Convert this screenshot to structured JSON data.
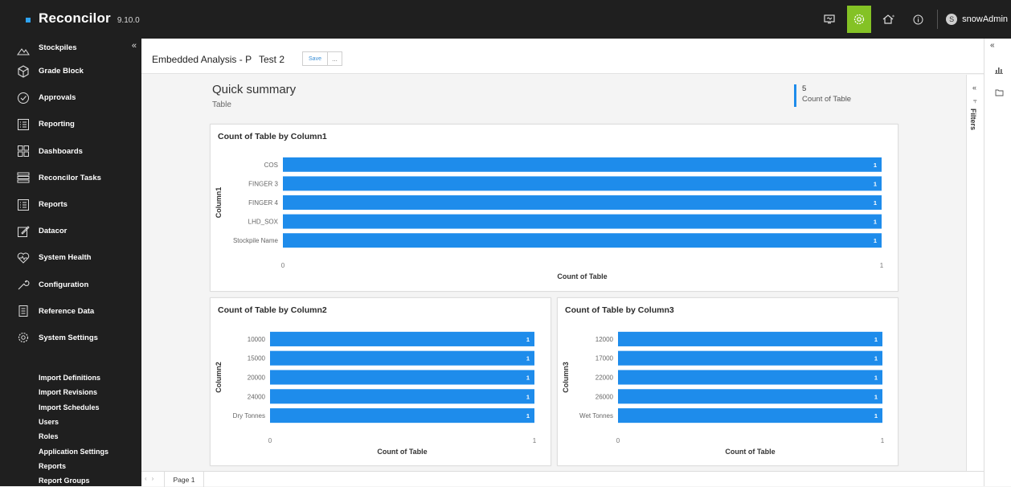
{
  "app": {
    "name": "Reconcilor",
    "version": "9.10.0",
    "user": "snowAdmin",
    "user_initial": "S"
  },
  "sidebar": {
    "items": [
      {
        "label": "Stockpiles",
        "icon": "stockpile-icon"
      },
      {
        "label": "Grade Block",
        "icon": "cube-icon"
      },
      {
        "label": "Approvals",
        "icon": "check-circle-icon"
      },
      {
        "label": "Reporting",
        "icon": "list-icon"
      },
      {
        "label": "Dashboards",
        "icon": "grid-icon"
      },
      {
        "label": "Reconcilor Tasks",
        "icon": "stack-icon"
      },
      {
        "label": "Reports",
        "icon": "list-icon"
      },
      {
        "label": "Datacor",
        "icon": "edit-icon"
      },
      {
        "label": "System Health",
        "icon": "heart-icon"
      },
      {
        "label": "Configuration",
        "icon": "wrench-icon"
      },
      {
        "label": "Reference Data",
        "icon": "document-icon"
      },
      {
        "label": "System Settings",
        "icon": "gear-icon"
      }
    ],
    "sub_items": [
      "Import Definitions",
      "Import Revisions",
      "Import Schedules",
      "Users",
      "Roles",
      "Application Settings",
      "Reports",
      "Report Groups"
    ]
  },
  "report": {
    "title": "Embedded Analysis - P",
    "page_name": "Test 2",
    "save_label": "Save",
    "more_label": "...",
    "summary_title": "Quick summary",
    "summary_sub": "Table",
    "kpi_value": "5",
    "kpi_label": "Count of Table",
    "filters_label": "Filters",
    "tab_label": "Page 1"
  },
  "colors": {
    "bar": "#1e8ceb",
    "accent": "#84c225",
    "sidebar": "#1f1f1f"
  },
  "chart_data": [
    {
      "type": "bar",
      "orientation": "horizontal",
      "title": "Count of Table by Column1",
      "xlabel": "Count of Table",
      "ylabel": "Column1",
      "categories": [
        "COS",
        "FINGER 3",
        "FINGER 4",
        "LHD_SOX",
        "Stockpile Name"
      ],
      "values": [
        1,
        1,
        1,
        1,
        1
      ],
      "xlim": [
        0,
        1
      ],
      "xticks": [
        "0",
        "1"
      ]
    },
    {
      "type": "bar",
      "orientation": "horizontal",
      "title": "Count of Table by Column2",
      "xlabel": "Count of Table",
      "ylabel": "Column2",
      "categories": [
        "10000",
        "15000",
        "20000",
        "24000",
        "Dry Tonnes"
      ],
      "values": [
        1,
        1,
        1,
        1,
        1
      ],
      "xlim": [
        0,
        1
      ],
      "xticks": [
        "0",
        "1"
      ]
    },
    {
      "type": "bar",
      "orientation": "horizontal",
      "title": "Count of Table by Column3",
      "xlabel": "Count of Table",
      "ylabel": "Column3",
      "categories": [
        "12000",
        "17000",
        "22000",
        "26000",
        "Wet Tonnes"
      ],
      "values": [
        1,
        1,
        1,
        1,
        1
      ],
      "xlim": [
        0,
        1
      ],
      "xticks": [
        "0",
        "1"
      ]
    }
  ]
}
